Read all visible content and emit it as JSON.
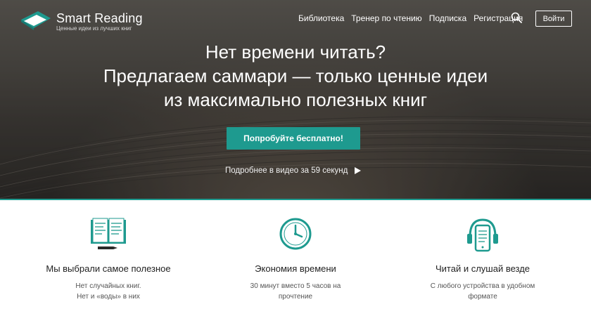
{
  "brand": {
    "name": "Smart Reading",
    "tagline": "Ценные идеи из лучших книг",
    "accent": "#1e9a8f"
  },
  "nav": {
    "items": [
      {
        "label": "Библиотека"
      },
      {
        "label": "Тренер по чтению"
      },
      {
        "label": "Подписка"
      },
      {
        "label": "Регистрация"
      }
    ],
    "search_icon": "search-icon",
    "login_label": "Войти"
  },
  "hero": {
    "line1": "Нет времени читать?",
    "line2": "Предлагаем саммари — только ценные идеи",
    "line3": "из максимально полезных книг",
    "cta_label": "Попробуйте бесплатно!",
    "video_label": "Подробнее в видео за 59 секунд"
  },
  "features": [
    {
      "icon": "open-book-icon",
      "title": "Мы выбрали самое полезное",
      "desc1": "Нет случайных книг.",
      "desc2": "Нет и «воды» в них"
    },
    {
      "icon": "clock-icon",
      "title": "Экономия времени",
      "desc1": "30 минут вместо 5 часов на",
      "desc2": "прочтение"
    },
    {
      "icon": "phone-headphones-icon",
      "title": "Читай и слушай везде",
      "desc1": "С любого устройства в удобном",
      "desc2": "формате"
    }
  ]
}
